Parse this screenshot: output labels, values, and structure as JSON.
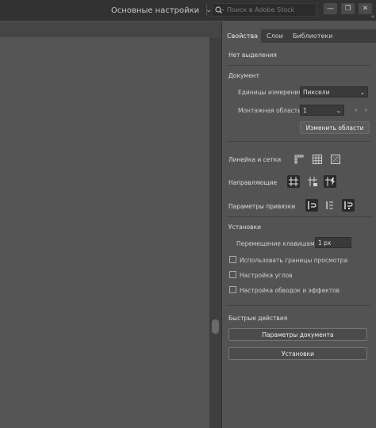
{
  "window": {
    "workspace_label": "Основные настройки",
    "search_placeholder": "Поиск в Adobe Stock",
    "controls": {
      "minimize": "—",
      "restore": "❐",
      "close": "✕"
    }
  },
  "panel": {
    "tabs": [
      {
        "label": "Свойства",
        "active": true
      },
      {
        "label": "Слои",
        "active": false
      },
      {
        "label": "Библиотеки",
        "active": false
      }
    ],
    "collapse_glyph": "«",
    "no_selection": "Нет выделения",
    "document": {
      "title": "Документ",
      "units_label": "Единицы измерения:",
      "units_value": "Пиксели",
      "artboard_label": "Монтажная область:",
      "artboard_value": "1",
      "edit_artboards_button": "Изменить области"
    },
    "rulers_grids_label": "Линейка и сетки",
    "guides_label": "Направляющие",
    "snap_label": "Параметры привязки",
    "preferences": {
      "title": "Установки",
      "keyboard_increment_label": "Перемещение клавишами:",
      "keyboard_increment_value": "1 px",
      "checkboxes": [
        {
          "label": "Использовать границы просмотра",
          "checked": false
        },
        {
          "label": "Настройка углов",
          "checked": false
        },
        {
          "label": "Настройка обводок и эффектов",
          "checked": false
        }
      ]
    },
    "quick_actions": {
      "title": "Быстрые действия",
      "document_setup_button": "Параметры документа",
      "preferences_button": "Установки"
    }
  },
  "colors": {
    "app_bg": "#535353",
    "topbar_bg": "#323232",
    "panel_bg": "#535353",
    "tabs_bg": "#3d3d3d"
  }
}
